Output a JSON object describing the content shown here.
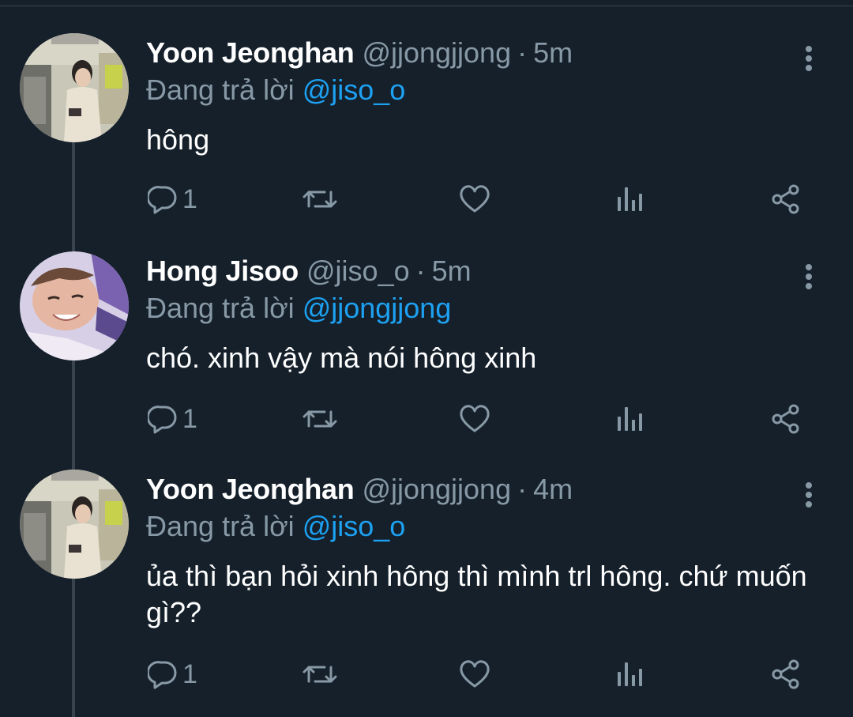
{
  "thread": [
    {
      "name": "Yoon Jeonghan",
      "handle": "@jjongjjong",
      "separator": "·",
      "time": "5m",
      "reply_prefix": "Đang trả lời",
      "reply_to": "@jiso_o",
      "text": "hông",
      "actions": {
        "reply_icon": "comment-icon",
        "reply_count": "1",
        "retweet_icon": "retweet-icon",
        "like_icon": "heart-icon",
        "analytics_icon": "analytics-icon",
        "share_icon": "share-icon"
      },
      "avatar_icon": "profile-photo"
    },
    {
      "name": "Hong Jisoo",
      "handle": "@jiso_o",
      "separator": "·",
      "time": "5m",
      "reply_prefix": "Đang trả lời",
      "reply_to": "@jjongjjong",
      "text": "chó. xinh vậy mà nói hông xinh",
      "actions": {
        "reply_icon": "comment-icon",
        "reply_count": "1",
        "retweet_icon": "retweet-icon",
        "like_icon": "heart-icon",
        "analytics_icon": "analytics-icon",
        "share_icon": "share-icon"
      },
      "avatar_icon": "profile-photo"
    },
    {
      "name": "Yoon Jeonghan",
      "handle": "@jjongjjong",
      "separator": "·",
      "time": "4m",
      "reply_prefix": "Đang trả lời",
      "reply_to": "@jiso_o",
      "text": "ủa thì bạn hỏi xinh hông thì mình trl hông. chứ muốn gì??",
      "actions": {
        "reply_icon": "comment-icon",
        "reply_count": "1",
        "retweet_icon": "retweet-icon",
        "like_icon": "heart-icon",
        "analytics_icon": "analytics-icon",
        "share_icon": "share-icon"
      },
      "avatar_icon": "profile-photo"
    }
  ],
  "colors": {
    "background": "#15202b",
    "primary_text": "#ffffff",
    "secondary_text": "#8899a6",
    "accent": "#1da1f2",
    "divider": "#38444d"
  }
}
